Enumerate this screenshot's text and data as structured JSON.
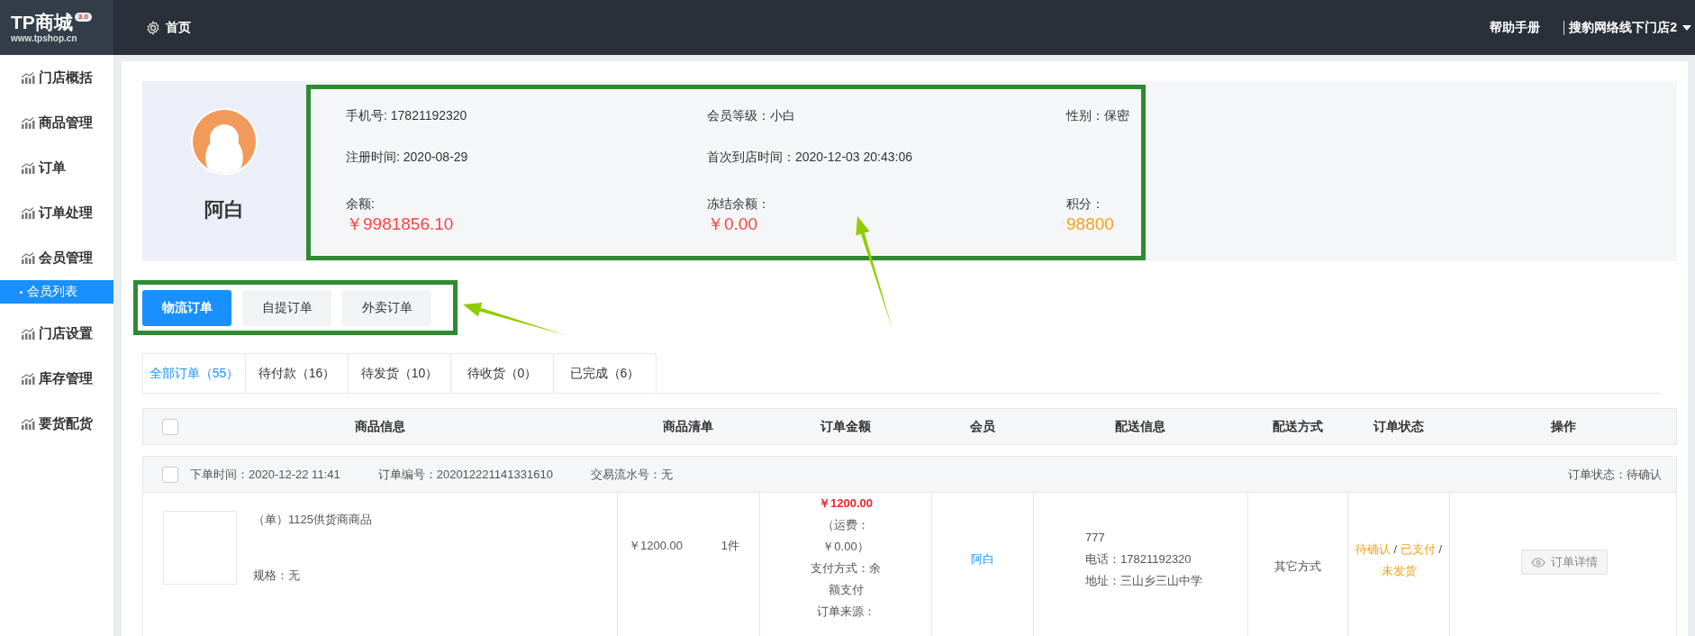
{
  "header": {
    "logo": {
      "title": "TP商城",
      "badge": "3.0",
      "url": "www.tpshop.cn"
    },
    "home": "首页",
    "help": "帮助手册",
    "store": "搜豹网络线下门店2"
  },
  "sidebar": {
    "items": [
      {
        "label": "门店概括",
        "kind": "menu",
        "selected": false
      },
      {
        "label": "商品管理",
        "kind": "menu",
        "selected": false
      },
      {
        "label": "订单",
        "kind": "menu",
        "selected": false
      },
      {
        "label": "订单处理",
        "kind": "menu",
        "selected": false
      },
      {
        "label": "会员管理",
        "kind": "menu",
        "selected": false
      },
      {
        "label": "会员列表",
        "kind": "submenu",
        "selected": true
      },
      {
        "label": "门店设置",
        "kind": "menu",
        "selected": false
      },
      {
        "label": "库存管理",
        "kind": "menu",
        "selected": false
      },
      {
        "label": "要货配货",
        "kind": "menu",
        "selected": false
      }
    ]
  },
  "member": {
    "name": "阿白",
    "columns": [
      {
        "lines": [
          "手机号: 17821192320",
          "注册时间: 2020-08-29"
        ],
        "stat": {
          "label": "余额:",
          "value": "￥9981856.10",
          "color": "#ff4343"
        }
      },
      {
        "lines": [
          "会员等级：小白",
          "首次到店时间：2020-12-03 20:43:06"
        ],
        "stat": {
          "label": "冻结余额：",
          "value": "￥0.00",
          "color": "#ff4343"
        }
      },
      {
        "lines": [
          "性别：保密"
        ],
        "stat": {
          "label": "积分：",
          "value": "98800",
          "color": "#f7a01d"
        }
      }
    ]
  },
  "order_types": [
    {
      "label": "物流订单",
      "selected": true
    },
    {
      "label": "自提订单",
      "selected": false
    },
    {
      "label": "外卖订单",
      "selected": false
    }
  ],
  "status_tabs": [
    {
      "label": "全部订单（55）",
      "selected": true
    },
    {
      "label": "待付款（16）",
      "selected": false
    },
    {
      "label": "待发货（10）",
      "selected": false
    },
    {
      "label": "待收货（0）",
      "selected": false
    },
    {
      "label": "已完成（6）",
      "selected": false
    }
  ],
  "table": {
    "checked": false,
    "columns": [
      "商品信息",
      "商品清单",
      "订单金额",
      "会员",
      "配送信息",
      "配送方式",
      "订单状态",
      "操作"
    ]
  },
  "orders": [
    {
      "checked": false,
      "meta": [
        "下单时间：2020-12-22 11:41",
        "订单编号：202012221141331610",
        "交易流水号：无"
      ],
      "status_text": "订单状态：待确认",
      "product": {
        "name": "（单）1125供货商商品",
        "spec": "规格：无"
      },
      "price": "￥1200.00",
      "quantity": "1件",
      "amount": "￥1200.00",
      "amount_details": [
        "（运费：",
        "￥0.00）",
        "支付方式：余",
        "额支付",
        "订单来源："
      ],
      "member": "阿白",
      "delivery": [
        "777",
        "电话：17821192320",
        "地址：三山乡三山中学"
      ],
      "delivery_method": "其它方式",
      "status": [
        {
          "text": "待确认",
          "kind": "state"
        },
        {
          "text": "/",
          "kind": "separator"
        },
        {
          "text": "已支付",
          "kind": "state"
        },
        {
          "text": "/",
          "kind": "separator"
        },
        {
          "text": "未发货",
          "kind": "state"
        }
      ],
      "action": "订单详情"
    }
  ]
}
